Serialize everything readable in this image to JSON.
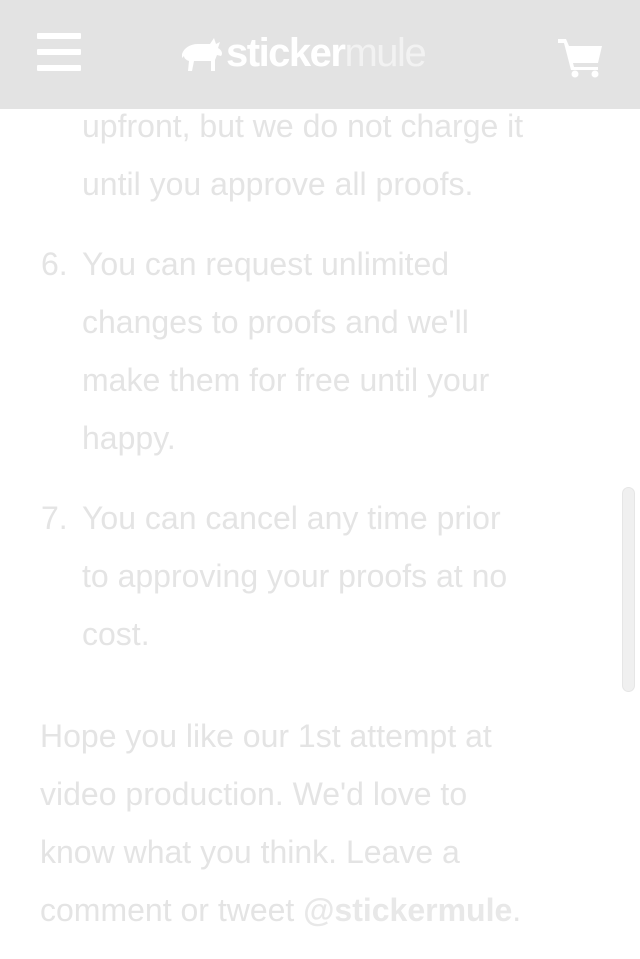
{
  "header": {
    "logo_primary": "sticker",
    "logo_secondary": "mule"
  },
  "list": {
    "item5_cont_line1": "upfront, but we do not charge it",
    "item5_cont_line2": "until you approve all proofs.",
    "items": [
      {
        "number": "6.",
        "lines": [
          "You can request unlimited",
          "changes to proofs and we'll",
          "make them for free until your",
          "happy."
        ]
      },
      {
        "number": "7.",
        "lines": [
          "You can cancel any time prior",
          "to approving your proofs at no",
          "cost."
        ]
      }
    ]
  },
  "closing": {
    "lines": [
      "Hope you like our 1st attempt at",
      "video production. We'd love to",
      "know what you think. Leave a",
      "comment or tweet "
    ],
    "handle": "@stickermule",
    "end_punct": "."
  },
  "icons": {
    "menu": "hamburger-menu-icon",
    "logo": "mule-logo-icon",
    "cart": "shopping-cart-icon"
  },
  "colors": {
    "header_bg": "#e3e3e3",
    "text": "#e4e4e4",
    "background": "#ffffff"
  }
}
